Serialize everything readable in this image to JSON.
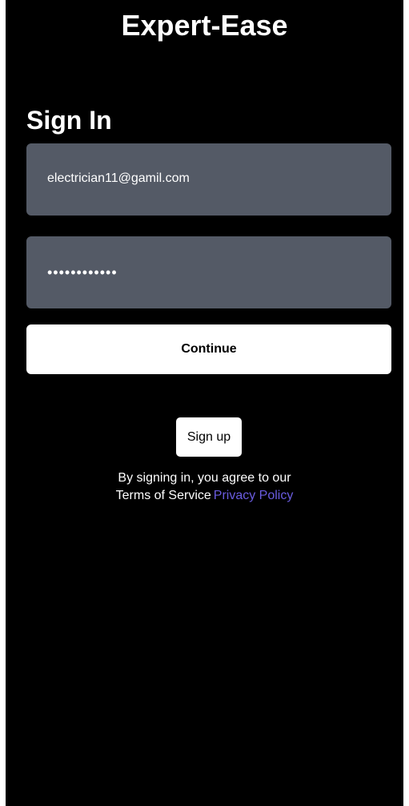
{
  "app": {
    "title": "Expert-Ease"
  },
  "signin": {
    "heading": "Sign In",
    "email_value": "electrician11@gamil.com",
    "password_value": "••••••••••••",
    "continue_label": "Continue",
    "signup_label": "Sign up"
  },
  "terms": {
    "agree_text": "By signing in, you agree to our",
    "tos_label": "Terms of Service",
    "privacy_label": "Privacy Policy"
  },
  "colors": {
    "background": "#000000",
    "field_background": "#545a66",
    "button_background": "#ffffff",
    "link_accent": "#6a5ce0"
  }
}
